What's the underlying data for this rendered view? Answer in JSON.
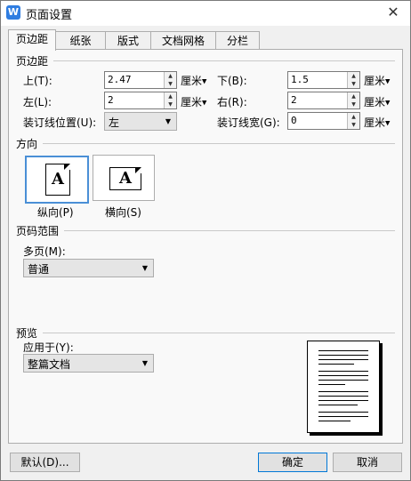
{
  "window": {
    "title": "页面设置",
    "app_icon": "W",
    "close_symbol": "✕"
  },
  "tabs": [
    {
      "label": "页边距",
      "active": true
    },
    {
      "label": "纸张",
      "active": false
    },
    {
      "label": "版式",
      "active": false
    },
    {
      "label": "文档网格",
      "active": false
    },
    {
      "label": "分栏",
      "active": false
    }
  ],
  "margins": {
    "section_title": "页边距",
    "top": {
      "label": "上(T):",
      "value": "2.47",
      "unit": "厘米"
    },
    "bottom": {
      "label": "下(B):",
      "value": "1.5",
      "unit": "厘米"
    },
    "left": {
      "label": "左(L):",
      "value": "2",
      "unit": "厘米"
    },
    "right": {
      "label": "右(R):",
      "value": "2",
      "unit": "厘米"
    },
    "gutter_position": {
      "label": "装订线位置(U):",
      "value": "左"
    },
    "gutter_width": {
      "label": "装订线宽(G):",
      "value": "0",
      "unit": "厘米"
    }
  },
  "orientation": {
    "section_title": "方向",
    "glyph": "A",
    "portrait": {
      "label": "纵向(P)",
      "selected": true
    },
    "landscape": {
      "label": "横向(S)",
      "selected": false
    }
  },
  "pages": {
    "section_title": "页码范围",
    "multiple_label": "多页(M):",
    "multiple_value": "普通"
  },
  "preview": {
    "section_title": "预览",
    "apply_label": "应用于(Y):",
    "apply_value": "整篇文档"
  },
  "buttons": {
    "default": "默认(D)...",
    "ok": "确定",
    "cancel": "取消"
  }
}
